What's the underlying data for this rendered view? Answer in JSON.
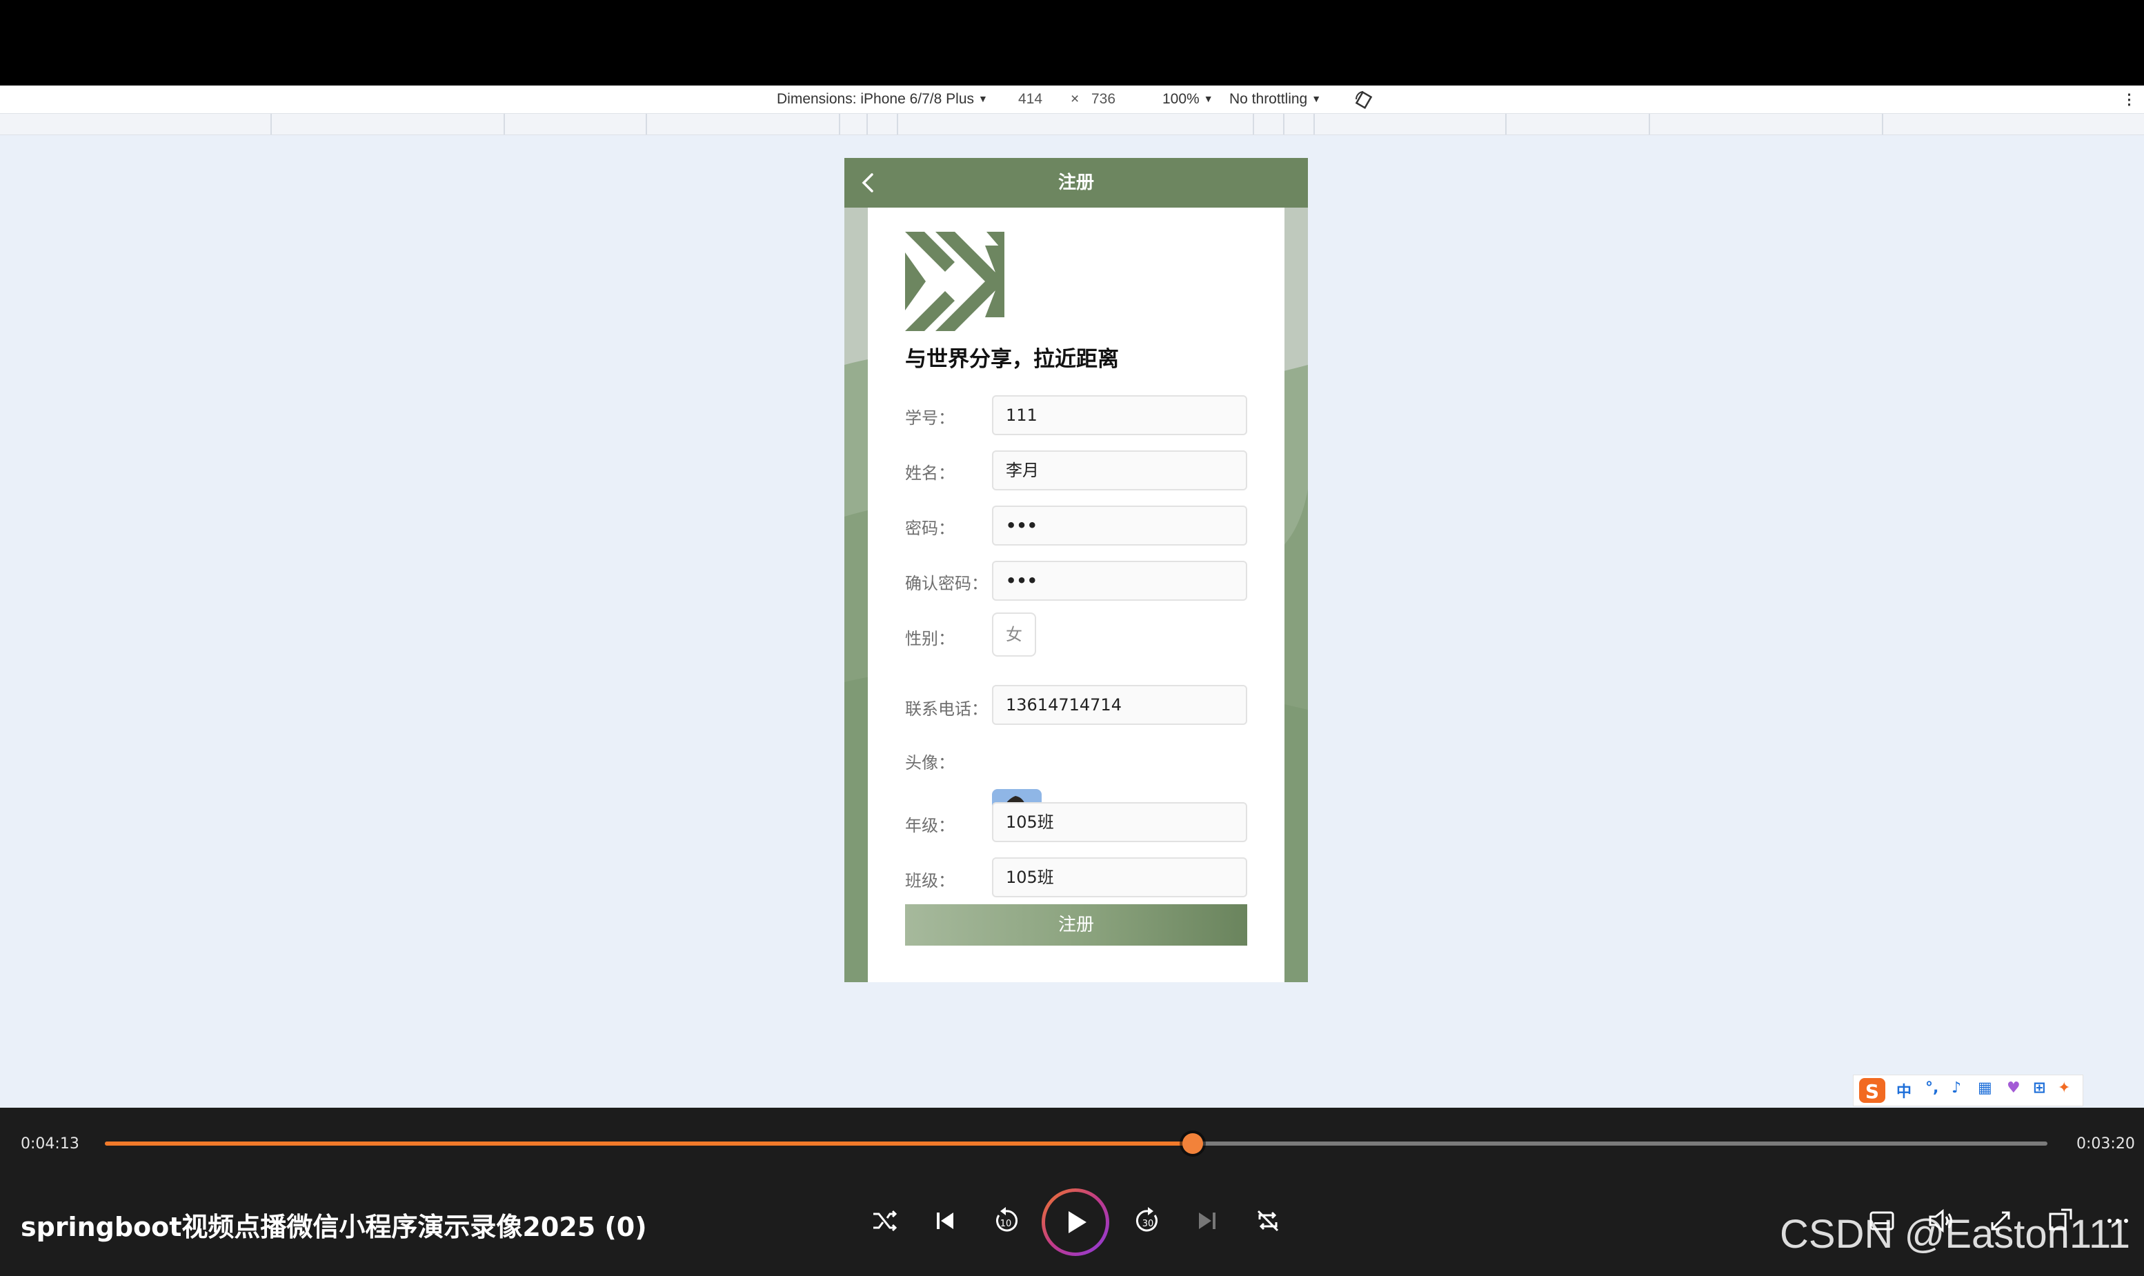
{
  "devtools": {
    "device_label": "Dimensions: iPhone 6/7/8 Plus",
    "width": "414",
    "times": "×",
    "height": "736",
    "zoom": "100%",
    "throttling": "No throttling"
  },
  "app": {
    "nav_title": "注册",
    "slogan": "与世界分享，拉近距离",
    "fields": [
      {
        "label": "学号：",
        "value": "111"
      },
      {
        "label": "姓名：",
        "value": "李月"
      },
      {
        "label": "密码：",
        "value": "•••"
      },
      {
        "label": "确认密码：",
        "value": "•••"
      },
      {
        "label": "性别：",
        "value": "女"
      },
      {
        "label": "联系电话：",
        "value": "13614714714"
      },
      {
        "label": "头像：",
        "value": ""
      },
      {
        "label": "年级：",
        "value": "105班"
      },
      {
        "label": "班级：",
        "value": "105班"
      }
    ],
    "submit_label": "注册",
    "theme_color": "#6d8660"
  },
  "ime": {
    "mode": "中"
  },
  "player": {
    "time_current": "0:04:13",
    "time_total": "0:03:20",
    "progress": 0.56,
    "video_title": "springboot视频点播微信小程序演示录像2025 (0)",
    "accent": "#f27a2a"
  },
  "watermark": "CSDN @Easton111"
}
